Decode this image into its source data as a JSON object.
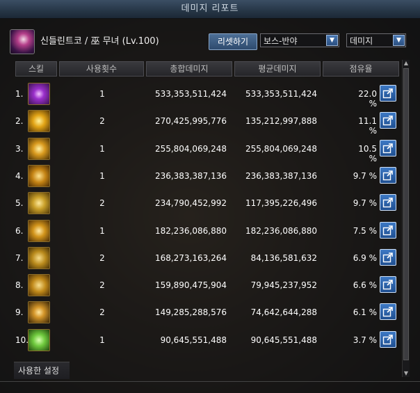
{
  "window": {
    "title": "데미지 리포트"
  },
  "header": {
    "character_name": "신들린트코 / 巫 무녀 (Lv.100)",
    "reset_label": "리셋하기",
    "target_select": "보스-반야",
    "metric_select": "데미지"
  },
  "columns": [
    "스킬",
    "사용횟수",
    "총합데미지",
    "평균데미지",
    "점유율"
  ],
  "rows": [
    {
      "rank": "1.",
      "uses": "1",
      "total": "533,353,511,424",
      "avg": "533,353,511,424",
      "share": "22.0 %",
      "icon": "skill-icon-1"
    },
    {
      "rank": "2.",
      "uses": "2",
      "total": "270,425,995,776",
      "avg": "135,212,997,888",
      "share": "11.1 %",
      "icon": "skill-icon-2"
    },
    {
      "rank": "3.",
      "uses": "1",
      "total": "255,804,069,248",
      "avg": "255,804,069,248",
      "share": "10.5 %",
      "icon": "skill-icon-3"
    },
    {
      "rank": "4.",
      "uses": "1",
      "total": "236,383,387,136",
      "avg": "236,383,387,136",
      "share": "9.7 %",
      "icon": "skill-icon-4"
    },
    {
      "rank": "5.",
      "uses": "2",
      "total": "234,790,452,992",
      "avg": "117,395,226,496",
      "share": "9.7 %",
      "icon": "skill-icon-5"
    },
    {
      "rank": "6.",
      "uses": "1",
      "total": "182,236,086,880",
      "avg": "182,236,086,880",
      "share": "7.5 %",
      "icon": "skill-icon-6"
    },
    {
      "rank": "7.",
      "uses": "2",
      "total": "168,273,163,264",
      "avg": "84,136,581,632",
      "share": "6.9 %",
      "icon": "skill-icon-7"
    },
    {
      "rank": "8.",
      "uses": "2",
      "total": "159,890,475,904",
      "avg": "79,945,237,952",
      "share": "6.6 %",
      "icon": "skill-icon-8"
    },
    {
      "rank": "9.",
      "uses": "2",
      "total": "149,285,288,576",
      "avg": "74,642,644,288",
      "share": "6.1 %",
      "icon": "skill-icon-9"
    },
    {
      "rank": "10.",
      "uses": "1",
      "total": "90,645,551,488",
      "avg": "90,645,551,488",
      "share": "3.7 %",
      "icon": "skill-icon-10"
    }
  ],
  "footer": {
    "settings_label": "사용한 설정"
  },
  "colors": {
    "accent": "#3d79c4",
    "title_bar": "#263646",
    "header_bg": "#2a2a2e"
  }
}
